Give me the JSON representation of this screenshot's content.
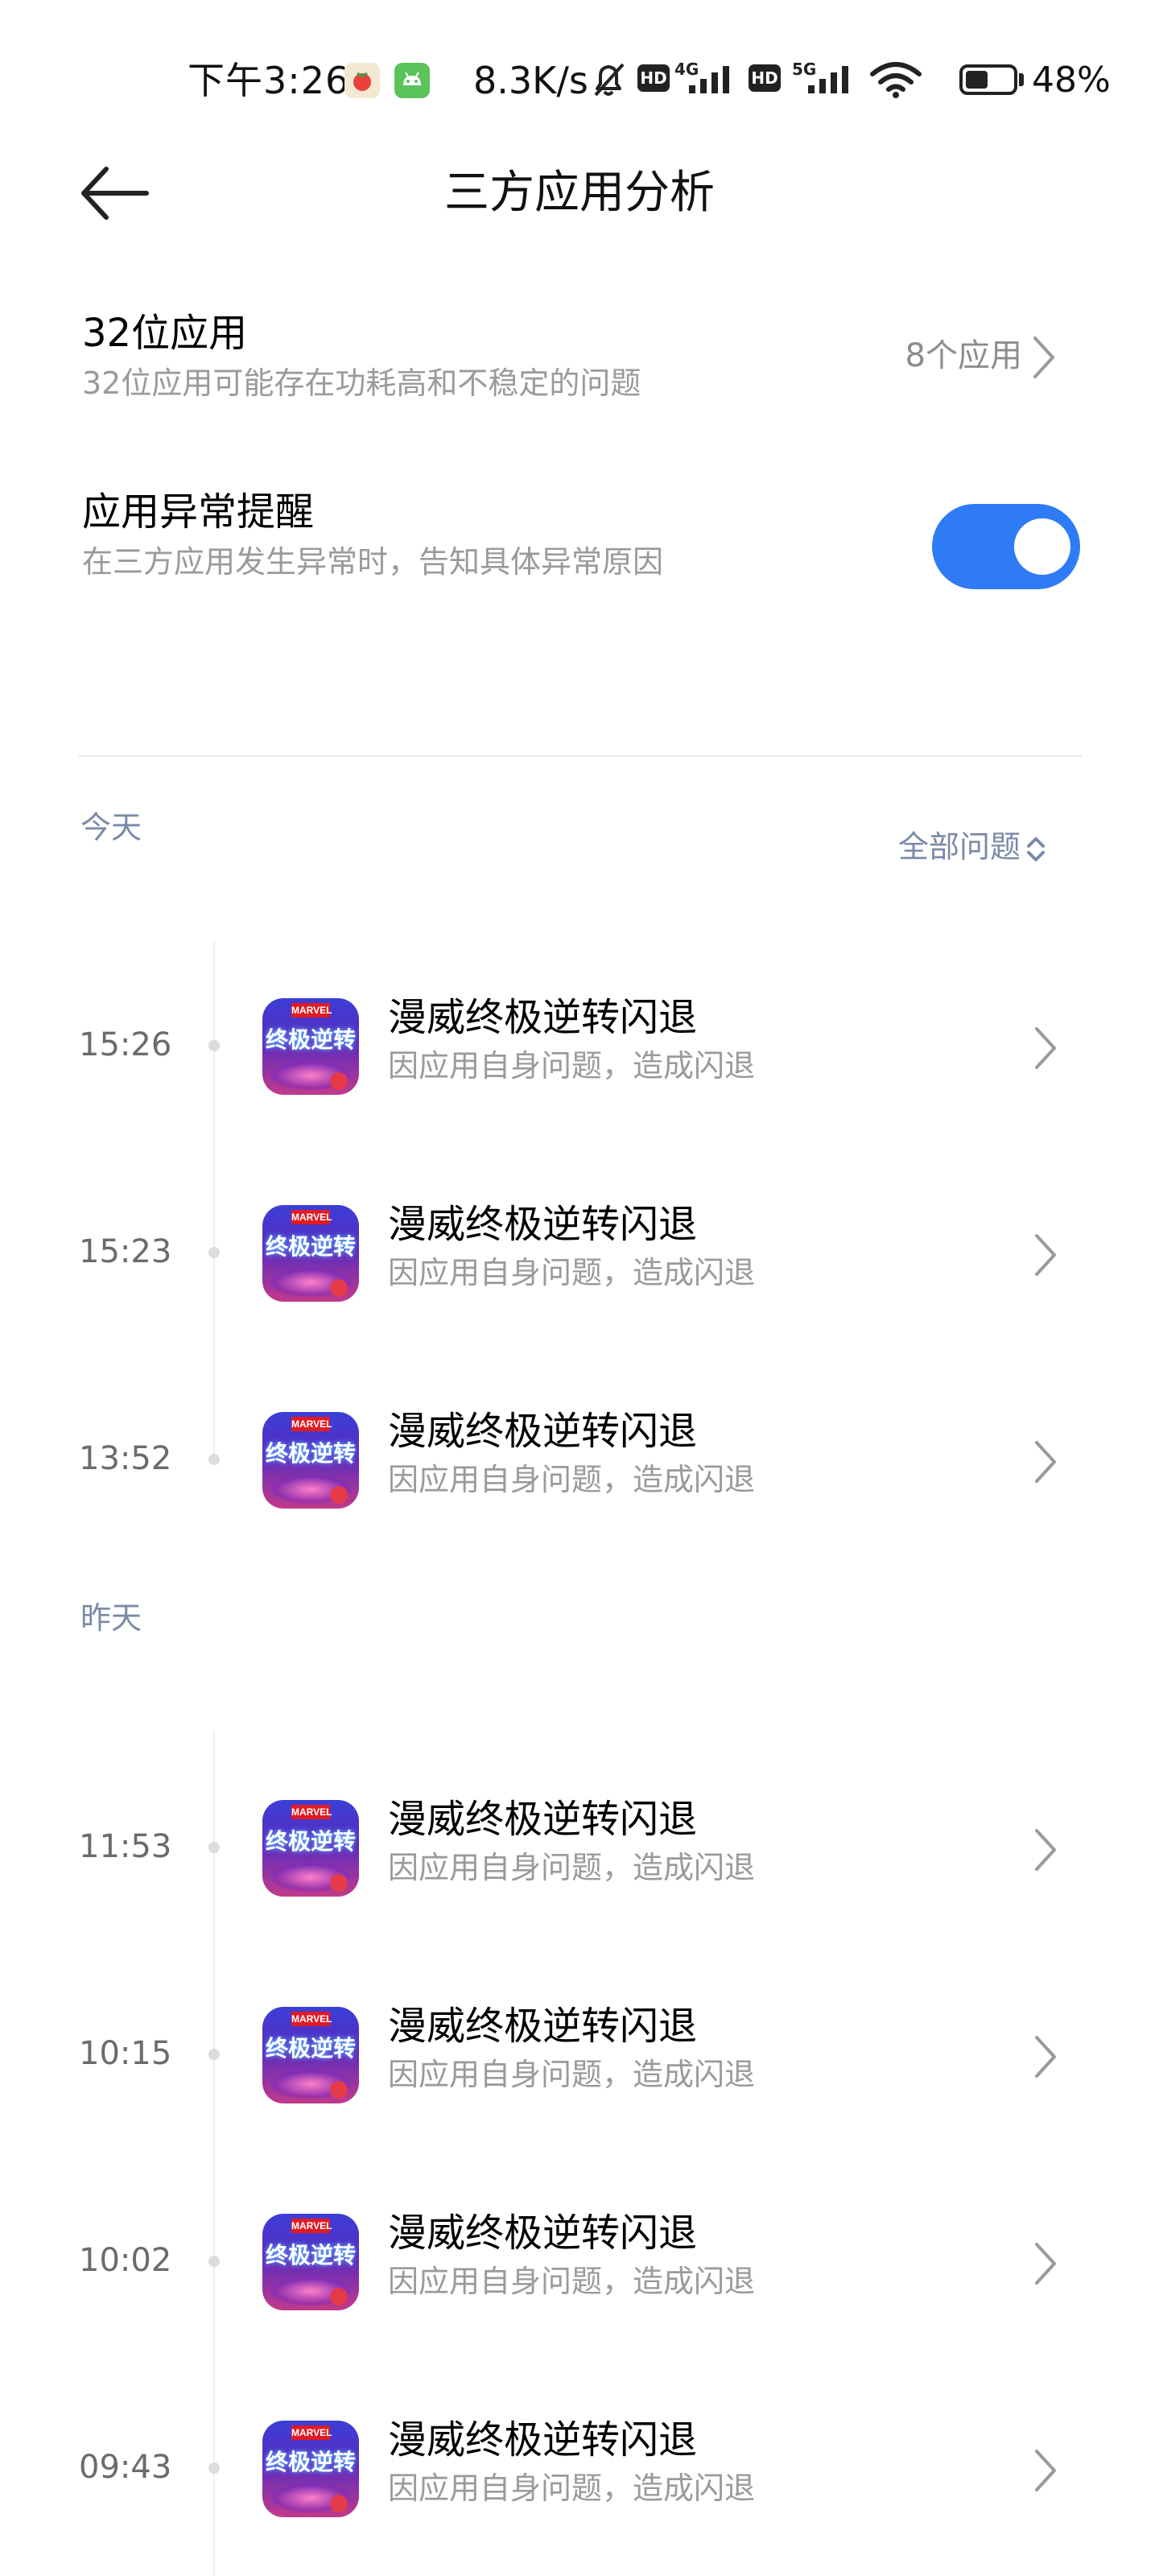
{
  "status_bar": {
    "time": "下午3:26",
    "network_speed": "8.3K/s",
    "sim1_hd": "HD",
    "sim1_network": "4G",
    "sim2_hd": "HD",
    "sim2_network": "5G",
    "battery_percent": "48%",
    "battery_level": 0.48,
    "icons": [
      "tomato-app-icon",
      "android-app-icon",
      "mute-bell-icon",
      "signal-icon",
      "wifi-icon",
      "battery-icon"
    ]
  },
  "header": {
    "title": "三方应用分析",
    "back_icon": "back-arrow-icon"
  },
  "settings": {
    "apps_32bit": {
      "title": "32位应用",
      "subtitle": "32位应用可能存在功耗高和不稳定的问题",
      "value": "8个应用"
    },
    "anomaly_alert": {
      "title": "应用异常提醒",
      "subtitle": "在三方应用发生异常时，告知具体异常原因",
      "enabled": true,
      "accent_color": "#2f7bf6"
    }
  },
  "filter": {
    "selected": "全部问题",
    "icon": "up-down-chevron-icon"
  },
  "sections": [
    {
      "label": "今天",
      "items": [
        {
          "time": "15:26",
          "title": "漫威终极逆转闪退",
          "subtitle": "因应用自身问题，造成闪退"
        },
        {
          "time": "15:23",
          "title": "漫威终极逆转闪退",
          "subtitle": "因应用自身问题，造成闪退"
        },
        {
          "time": "13:52",
          "title": "漫威终极逆转闪退",
          "subtitle": "因应用自身问题，造成闪退"
        }
      ]
    },
    {
      "label": "昨天",
      "items": [
        {
          "time": "11:53",
          "title": "漫威终极逆转闪退",
          "subtitle": "因应用自身问题，造成闪退"
        },
        {
          "time": "10:15",
          "title": "漫威终极逆转闪退",
          "subtitle": "因应用自身问题，造成闪退"
        },
        {
          "time": "10:02",
          "title": "漫威终极逆转闪退",
          "subtitle": "因应用自身问题，造成闪退"
        },
        {
          "time": "09:43",
          "title": "漫威终极逆转闪退",
          "subtitle": "因应用自身问题，造成闪退"
        }
      ]
    }
  ],
  "app_icon": {
    "badge": "MARVEL",
    "text": "终极逆转"
  }
}
